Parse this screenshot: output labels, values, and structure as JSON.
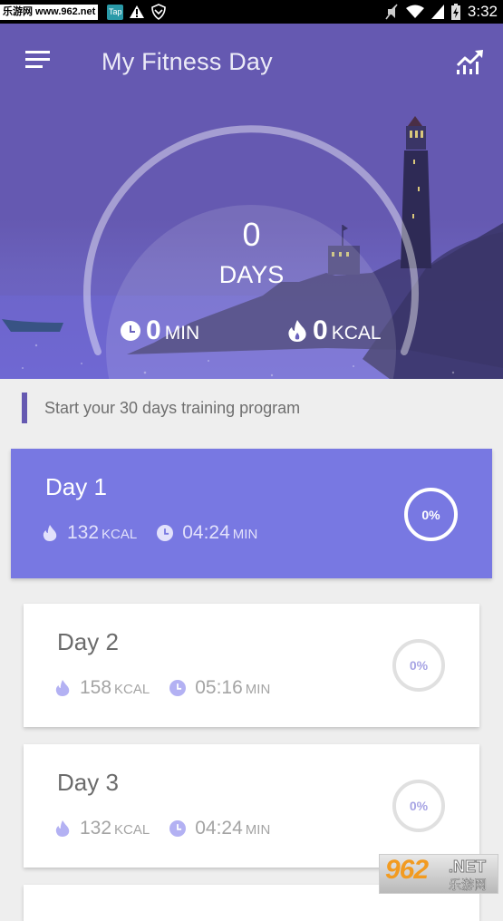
{
  "status_bar": {
    "site_label": "乐游网 www.962.net",
    "tap_label": "Tap",
    "time": "3:32",
    "icons": [
      "mute-icon",
      "wifi-icon",
      "signal-icon",
      "battery-charging-icon"
    ]
  },
  "toolbar": {
    "title": "My Fitness Day",
    "menu_icon": "hamburger-menu-icon",
    "stats_icon": "trending-chart-icon"
  },
  "summary": {
    "days_value": "0",
    "days_label": "DAYS",
    "minutes_value": "0",
    "minutes_unit": "MIN",
    "kcal_value": "0",
    "kcal_unit": "KCAL"
  },
  "section": {
    "header": "Start your 30 days training program"
  },
  "days": [
    {
      "title": "Day 1",
      "kcal": "132",
      "kcal_unit": "KCAL",
      "duration": "04:24",
      "duration_unit": "MIN",
      "progress": "0%",
      "active": true
    },
    {
      "title": "Day 2",
      "kcal": "158",
      "kcal_unit": "KCAL",
      "duration": "05:16",
      "duration_unit": "MIN",
      "progress": "0%",
      "active": false
    },
    {
      "title": "Day 3",
      "kcal": "132",
      "kcal_unit": "KCAL",
      "duration": "04:24",
      "duration_unit": "MIN",
      "progress": "0%",
      "active": false
    }
  ],
  "watermark": {
    "brand": "962",
    "net": ".NET",
    "cn": "乐游网"
  },
  "colors": {
    "primary": "#6559b1",
    "active_card": "#7878e2",
    "icon_tint": "#b3b1f3"
  }
}
